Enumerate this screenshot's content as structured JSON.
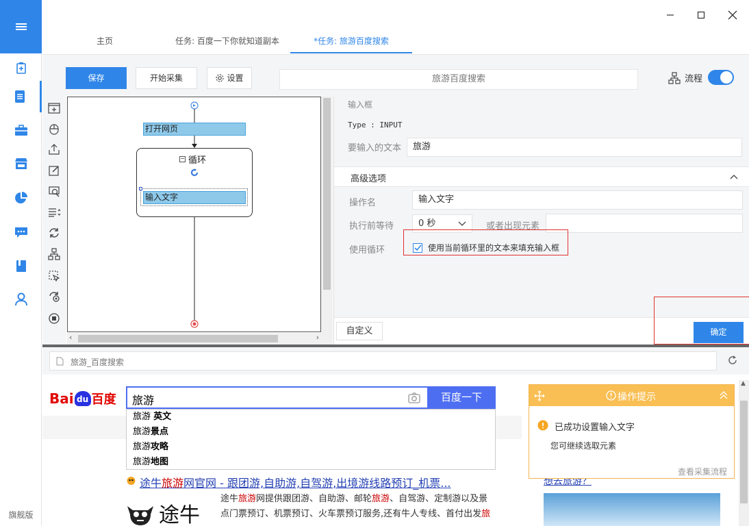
{
  "window": {
    "title": "旅游百度搜索"
  },
  "nav": {
    "items": [
      "new-task-icon",
      "task-list-icon",
      "toolbox-icon",
      "store-icon",
      "chart-icon",
      "message-icon",
      "book-icon",
      "user-icon"
    ],
    "footer": "旗舰版"
  },
  "tabs": [
    {
      "label": "主页"
    },
    {
      "label": "任务: 百度一下你就知道副本"
    },
    {
      "label": "*任务: 旅游百度搜索"
    }
  ],
  "toolbar": {
    "save_label": "保存",
    "start_label": "开始采集",
    "settings_label": "设置",
    "task_title": "旅游百度搜索",
    "flow_label": "流程",
    "flow_enabled": true
  },
  "canvas": {
    "open_page": "打开网页",
    "loop": "循环",
    "input_text": "输入文字"
  },
  "props": {
    "heading": "输入框",
    "type_line": "Type : INPUT",
    "text_label": "要输入的文本",
    "text_value": "旅游",
    "advanced": "高级选项",
    "op_name_label": "操作名",
    "op_name_value": "输入文字",
    "wait_label": "执行前等待",
    "wait_value": "0 秒",
    "or_label": "或者出现元素",
    "or_value": "",
    "loop_label": "使用循环",
    "loop_checkbox": "使用当前循环里的文本来填充输入框",
    "loop_checked": true,
    "custom_btn": "自定义",
    "ok_btn": "确定"
  },
  "browser": {
    "url": "旅游_百度搜索"
  },
  "web": {
    "logo_bai": "Bai",
    "logo_du": "du",
    "logo_cn": "百度",
    "query": "旅游",
    "search_btn": "百度一下",
    "suggestions": [
      {
        "a": "旅游 ",
        "b": "英文"
      },
      {
        "a": "旅游",
        "b": "景点"
      },
      {
        "a": "旅游",
        "b": "攻略"
      },
      {
        "a": "旅游",
        "b": "地图"
      }
    ],
    "result_title_1": "途牛",
    "result_title_2": "旅游",
    "result_title_3": "网官网 - 跟团游,自助游,自驾游,出境游线路预订_机票...",
    "result_logo": "途牛",
    "result_desc_1": "途牛",
    "result_desc_2": "旅游",
    "result_desc_3": "网提供跟团游、自助游、邮轮",
    "result_desc_4": "旅游",
    "result_desc_5": "、自驾游、定制游以及景点门票预订、机票预订、火车票预订服务,还有牛人专线、首付出发",
    "result_desc_6": "旅",
    "hint_title": "操作提示",
    "hint_msg": "已成功设置输入文字",
    "hint_sub": "您可继续选取元素",
    "hint_link": "查看采集流程",
    "side_link": "想去旅游？"
  },
  "colors": {
    "accent": "#2f86e8",
    "hint": "#f9bf54",
    "baidu_blue": "#4e6ef2",
    "baidu_red": "#e10602",
    "flow_step": "#8ec9ea"
  }
}
